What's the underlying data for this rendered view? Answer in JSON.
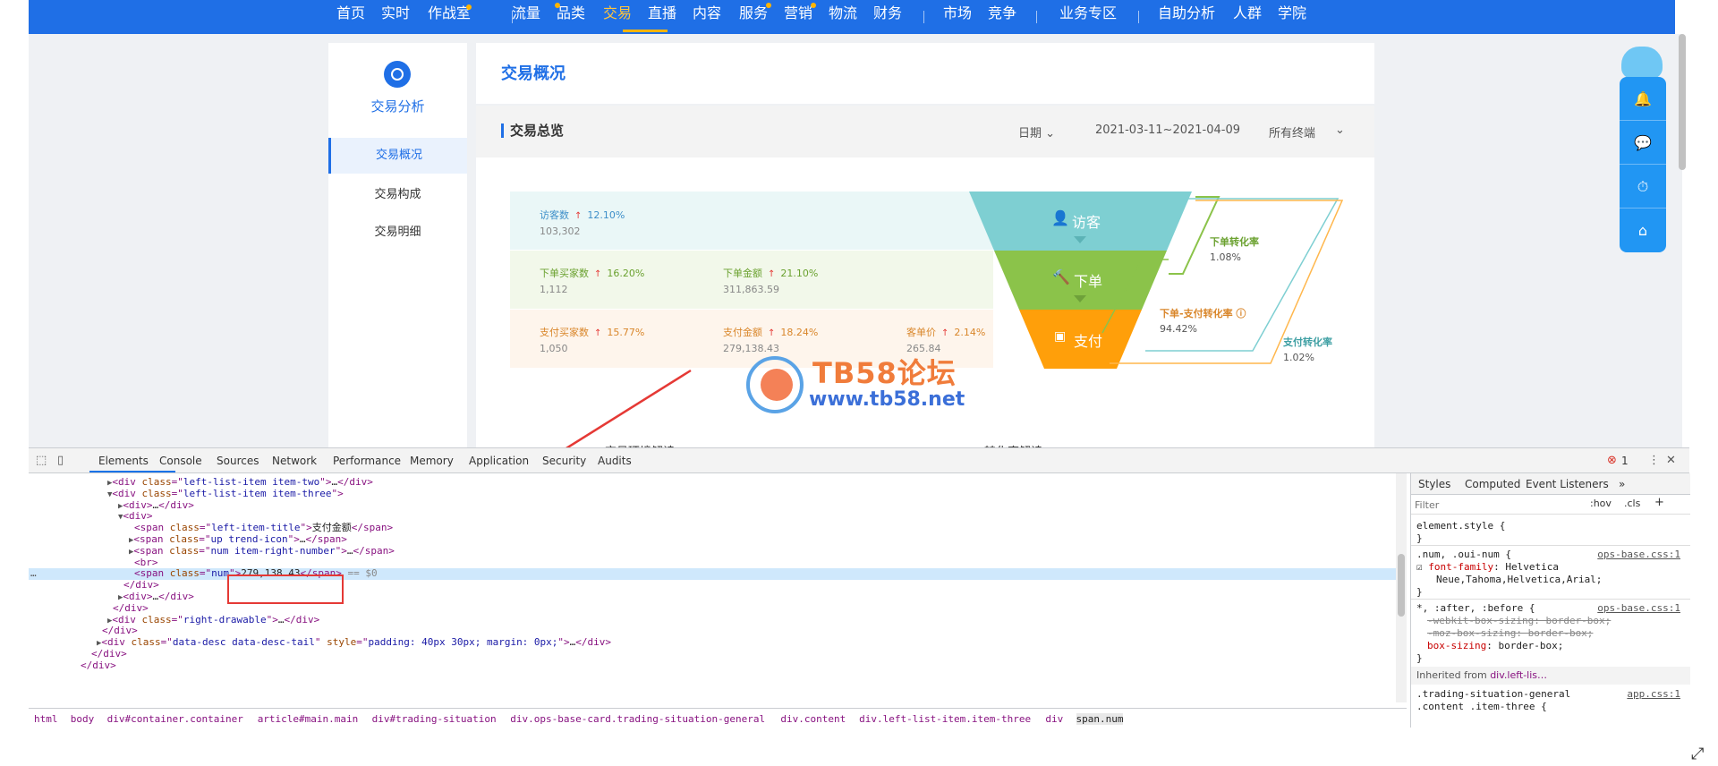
{
  "topnav": {
    "items": [
      "首页",
      "实时",
      "作战室",
      "流量",
      "品类",
      "交易",
      "直播",
      "内容",
      "服务",
      "营销",
      "物流",
      "财务",
      "市场",
      "竞争",
      "业务专区",
      "自助分析",
      "人群",
      "学院"
    ],
    "active": "交易"
  },
  "leftnav": {
    "title": "交易分析",
    "items": [
      "交易概况",
      "交易构成",
      "交易明细"
    ]
  },
  "main": {
    "title": "交易概况",
    "card_title": "交易总览",
    "filter_date_label": "日期",
    "date_range": "2021-03-11~2021-04-09",
    "terminal": "所有终端"
  },
  "metrics": {
    "visitors": {
      "label": "访客数",
      "pct": "12.10%",
      "value": "103,302"
    },
    "order_buyers": {
      "label": "下单买家数",
      "pct": "16.20%",
      "value": "1,112"
    },
    "order_amount": {
      "label": "下单金额",
      "pct": "21.10%",
      "value": "311,863.59"
    },
    "pay_buyers": {
      "label": "支付买家数",
      "pct": "15.77%",
      "value": "1,050"
    },
    "pay_amount": {
      "label": "支付金额",
      "pct": "18.24%",
      "value": "279,138.43"
    },
    "unit_price": {
      "label": "客单价",
      "pct": "2.14%",
      "value": "265.84"
    }
  },
  "funnel": {
    "visit": "访客",
    "order": "下单",
    "pay": "支付",
    "order_conv_label": "下单转化率",
    "order_conv": "1.08%",
    "order_pay_conv_label": "下单-支付转化率",
    "order_pay_conv": "94.42%",
    "pay_conv_label": "支付转化率",
    "pay_conv": "1.02%"
  },
  "watermark": {
    "title": "TB58论坛",
    "url": "www.tb58.net"
  },
  "below": {
    "left": "交易环境解读",
    "right": "转化率解读"
  },
  "devtools": {
    "tabs": [
      "Elements",
      "Console",
      "Sources",
      "Network",
      "Performance",
      "Memory",
      "Application",
      "Security",
      "Audits"
    ],
    "error_count": "1",
    "dom_lines": [
      {
        "indent": 88,
        "arrow": "▶",
        "html": "<span class=\"tag\">&lt;div </span><span class=\"attr\">class</span><span class=\"tag\">=\"</span><span class=\"aval\">left-list-item item-two</span><span class=\"tag\">\"&gt;</span><span class=\"txt\">…</span><span class=\"tag\">&lt;/div&gt;</span>"
      },
      {
        "indent": 88,
        "arrow": "▼",
        "html": "<span class=\"tag\">&lt;div </span><span class=\"attr\">class</span><span class=\"tag\">=\"</span><span class=\"aval\">left-list-item item-three</span><span class=\"tag\">\"&gt;</span>"
      },
      {
        "indent": 100,
        "arrow": "▶",
        "html": "<span class=\"tag\">&lt;div&gt;</span><span class=\"txt\">…</span><span class=\"tag\">&lt;/div&gt;</span>"
      },
      {
        "indent": 100,
        "arrow": "▼",
        "html": "<span class=\"tag\">&lt;div&gt;</span>"
      },
      {
        "indent": 118,
        "arrow": "",
        "html": "<span class=\"tag\">&lt;span </span><span class=\"attr\">class</span><span class=\"tag\">=\"</span><span class=\"aval\">left-item-title</span><span class=\"tag\">\"&gt;</span><span class=\"txt\">支付金额</span><span class=\"tag\">&lt;/span&gt;</span>"
      },
      {
        "indent": 112,
        "arrow": "▶",
        "html": "<span class=\"tag\">&lt;span </span><span class=\"attr\">class</span><span class=\"tag\">=\"</span><span class=\"aval\">up trend-icon</span><span class=\"tag\">\"&gt;</span><span class=\"txt\">…</span><span class=\"tag\">&lt;/span&gt;</span>"
      },
      {
        "indent": 112,
        "arrow": "▶",
        "html": "<span class=\"tag\">&lt;span </span><span class=\"attr\">class</span><span class=\"tag\">=\"</span><span class=\"aval\">num item-right-number</span><span class=\"tag\">\"&gt;</span><span class=\"txt\">…</span><span class=\"tag\">&lt;/span&gt;</span>"
      },
      {
        "indent": 118,
        "arrow": "",
        "html": "<span class=\"tag\">&lt;br&gt;</span>"
      },
      {
        "indent": 118,
        "arrow": "",
        "html": "<span class=\"tag\">&lt;span </span><span class=\"attr\">class</span><span class=\"tag\">=\"</span><span class=\"aval\">num</span><span class=\"tag\">\"&gt;</span><span class=\"txt\">279,138.43</span><span class=\"tag\">&lt;/span&gt;</span><span class=\"dim\"> == $0</span>",
        "selected": true
      },
      {
        "indent": 106,
        "arrow": "",
        "html": "<span class=\"tag\">&lt;/div&gt;</span>"
      },
      {
        "indent": 100,
        "arrow": "▶",
        "html": "<span class=\"tag\">&lt;div&gt;</span><span class=\"txt\">…</span><span class=\"tag\">&lt;/div&gt;</span>"
      },
      {
        "indent": 94,
        "arrow": "",
        "html": "<span class=\"tag\">&lt;/div&gt;</span>"
      },
      {
        "indent": 88,
        "arrow": "▶",
        "html": "<span class=\"tag\">&lt;div </span><span class=\"attr\">class</span><span class=\"tag\">=\"</span><span class=\"aval\">right-drawable</span><span class=\"tag\">\"&gt;</span><span class=\"txt\">…</span><span class=\"tag\">&lt;/div&gt;</span>"
      },
      {
        "indent": 82,
        "arrow": "",
        "html": "<span class=\"tag\">&lt;/div&gt;</span>"
      },
      {
        "indent": 76,
        "arrow": "▶",
        "html": "<span class=\"tag\">&lt;div </span><span class=\"attr\">class</span><span class=\"tag\">=\"</span><span class=\"aval\">data-desc data-desc-tail</span><span class=\"tag\">\" </span><span class=\"attr\">style</span><span class=\"tag\">=\"</span><span class=\"aval\">padding: 40px 30px; margin: 0px;</span><span class=\"tag\">\"&gt;</span><span class=\"txt\">…</span><span class=\"tag\">&lt;/div&gt;</span>"
      },
      {
        "indent": 70,
        "arrow": "",
        "html": "<span class=\"tag\">&lt;/div&gt;</span>"
      },
      {
        "indent": 58,
        "arrow": "",
        "html": "<span class=\"tag\">&lt;/div&gt;</span>"
      }
    ],
    "breadcrumb": [
      "html",
      "body",
      "div#container.container",
      "article#main.main",
      "div#trading-situation",
      "div.ops-base-card.trading-situation-general",
      "div.content",
      "div.left-list-item.item-three",
      "div",
      "span.num"
    ],
    "styles_tabs": [
      "Styles",
      "Computed",
      "Event Listeners",
      "»"
    ],
    "filter_placeholder": "Filter",
    "hov": ":hov",
    "cls": ".cls",
    "rules": {
      "element_style": "element.style {",
      "close": "}",
      "num_selector": ".num, .oui-num {",
      "num_link": "ops-base.css:1",
      "font_family_prop": "font-family",
      "font_family_val": ": Helvetica",
      "font_family_val2": "Neue,Tahoma,Helvetica,Arial;",
      "after_selector": "*, :after, :before {",
      "after_link": "ops-base.css:1",
      "webkit": "-webkit-box-sizing: border-box;",
      "moz": "-moz-box-sizing: border-box;",
      "box_prop": "box-sizing",
      "box_val": ": border-box;",
      "inherited_label": "Inherited from",
      "inherited_from": "div.left-lis…",
      "general_selector": ".trading-situation-general",
      "general_link": "app.css:1",
      "general_selector2": ".content .item-three {"
    }
  }
}
